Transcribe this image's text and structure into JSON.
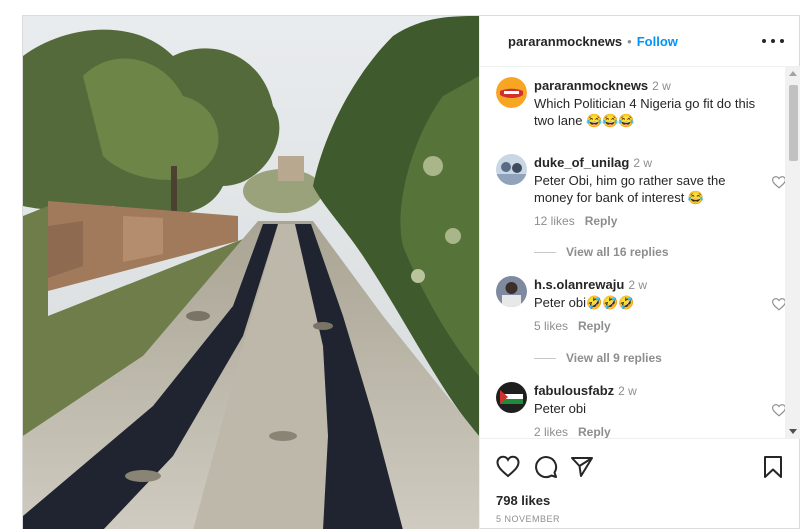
{
  "post": {
    "author": "pararanmocknews",
    "separator": "•",
    "follow_label": "Follow",
    "more_icon": "more-horizontal-icon",
    "caption": {
      "user": "pararanmocknews",
      "time": "2 w",
      "text": "Which Politician 4 Nigeria go fit do this two lane 😂😂😂"
    },
    "comments": [
      {
        "user": "duke_of_unilag",
        "time": "2 w",
        "text": "Peter Obi, him go rather save the money for bank of interest 😂",
        "likes": "12 likes",
        "reply_label": "Reply",
        "view_replies": "View all 16 replies"
      },
      {
        "user": "h.s.olanrewaju",
        "time": "2 w",
        "text": "Peter obi🤣🤣🤣",
        "likes": "5 likes",
        "reply_label": "Reply",
        "view_replies": "View all 9 replies"
      },
      {
        "user": "fabulousfabz",
        "time": "2 w",
        "text": "Peter obi",
        "likes": "2 likes",
        "reply_label": "Reply"
      }
    ],
    "likes_count": "798 likes",
    "date": "5 NOVEMBER",
    "icons": [
      "heart-icon",
      "comment-icon",
      "share-icon",
      "bookmark-icon"
    ],
    "colors": {
      "accent": "#0095f6",
      "muted": "#8e8e8e",
      "text": "#262626"
    }
  }
}
